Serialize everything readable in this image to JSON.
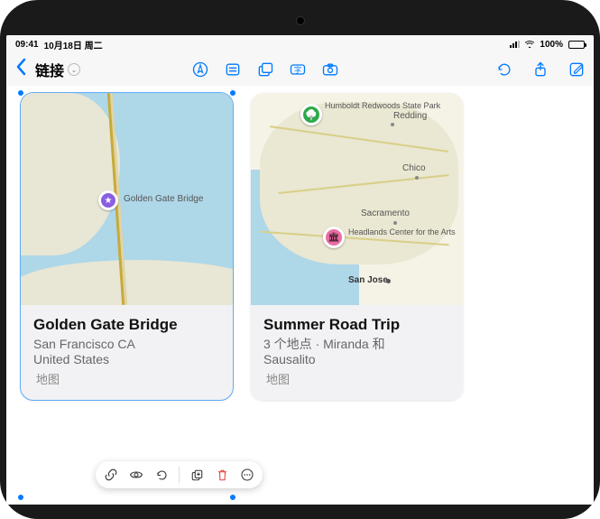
{
  "status": {
    "time": "09:41",
    "date": "10月18日 周二",
    "battery_pct": "100%"
  },
  "toolbar": {
    "back_title": "链接"
  },
  "cards": [
    {
      "title": "Golden Gate Bridge",
      "subtitle1": "San Francisco CA",
      "subtitle2": "United States",
      "source": "地图",
      "map_label": "Golden Gate Bridge",
      "selected": true
    },
    {
      "title": "Summer Road Trip",
      "subtitle1": "3 个地点 · Miranda 和",
      "subtitle2": "Sausalito",
      "source": "地图",
      "labels": {
        "humboldt": "Humboldt Redwoods State Park",
        "redding": "Redding",
        "chico": "Chico",
        "sacramento": "Sacramento",
        "headlands": "Headlands Center for the Arts",
        "sanjose": "San Jose"
      },
      "selected": false
    }
  ]
}
